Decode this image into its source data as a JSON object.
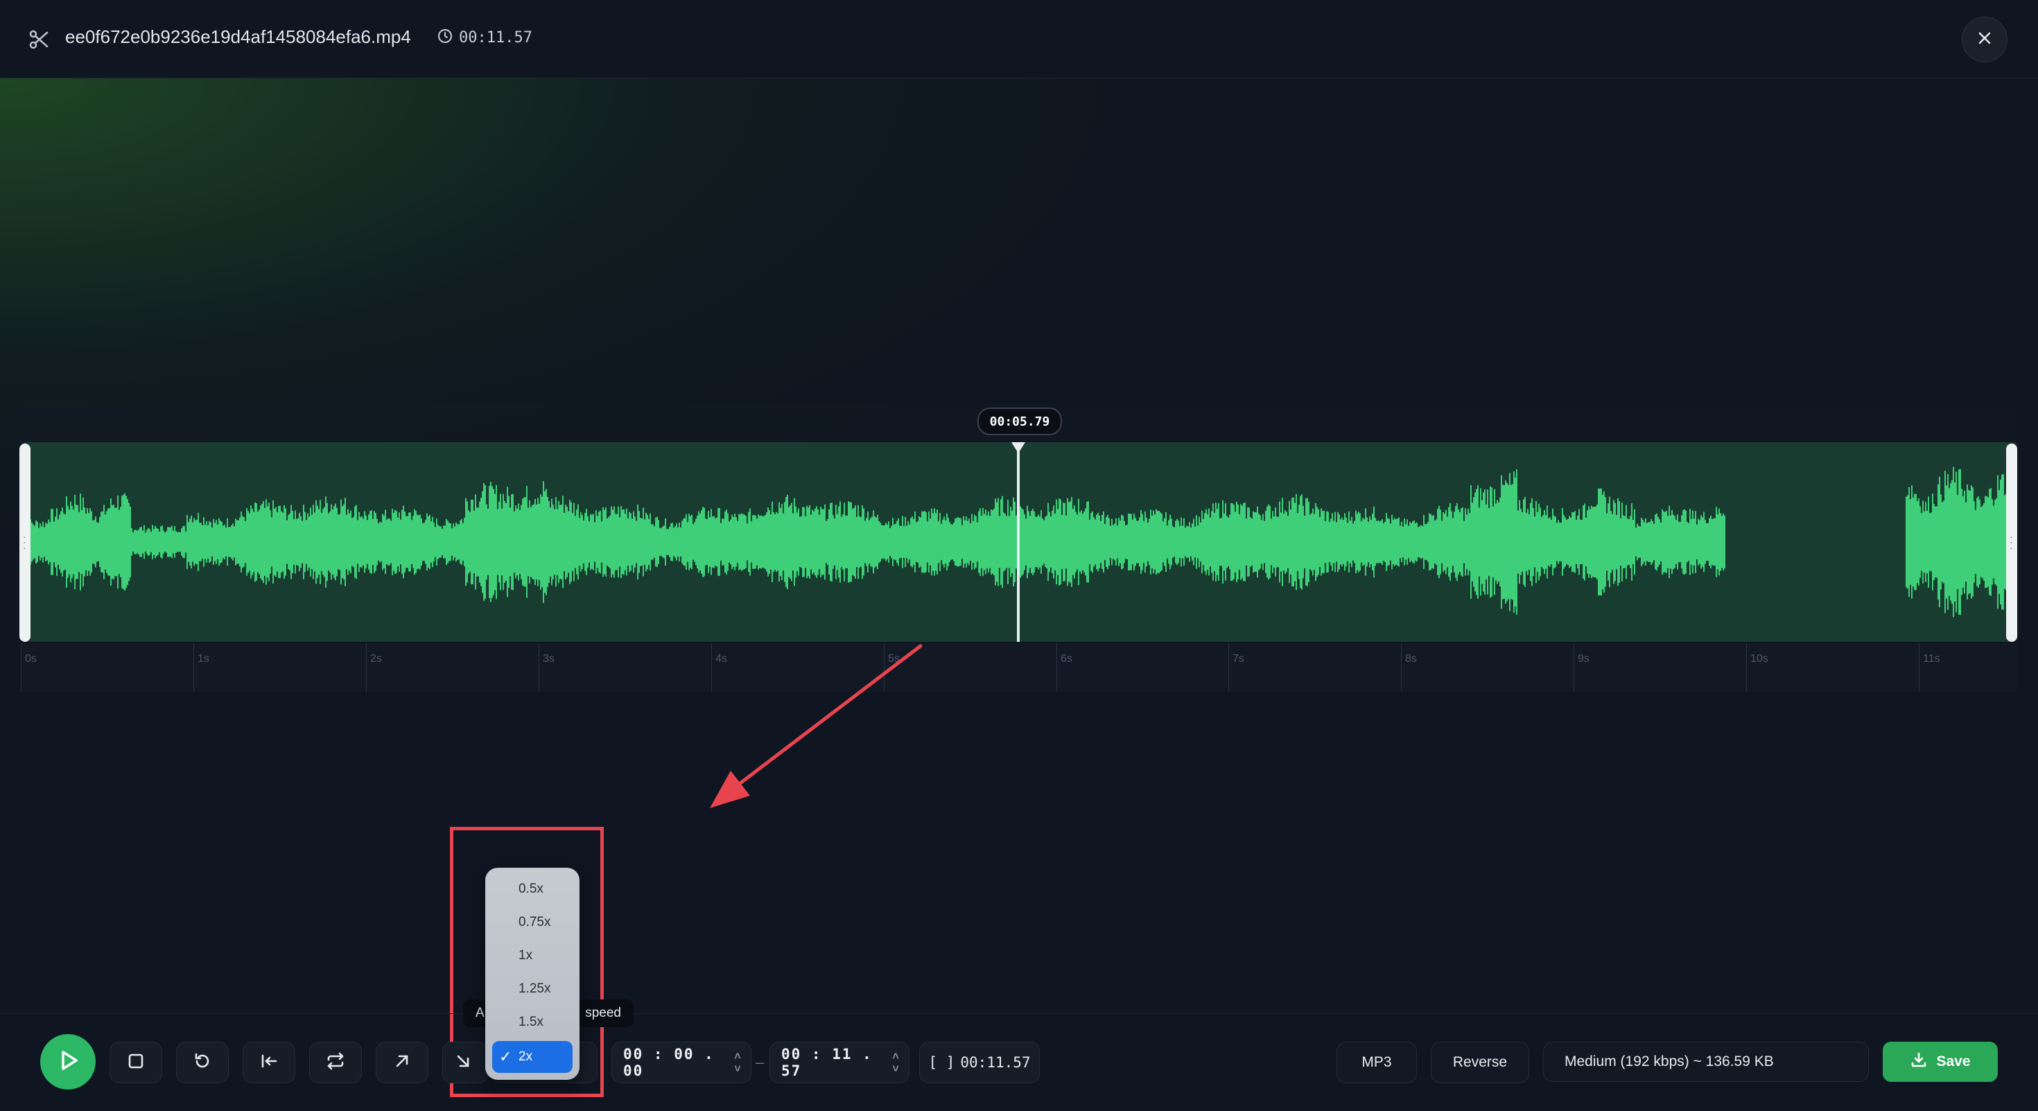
{
  "header": {
    "filename": "ee0f672e0b9236e19d4af1458084efa6.mp4",
    "duration": "00:11.57"
  },
  "waveform": {
    "playhead_time": "00:05.79",
    "playhead_fraction": 0.5,
    "wave_color": "#3ecf78",
    "ruler_labels": [
      "0s",
      "1s",
      "2s",
      "3s",
      "4s",
      "5s",
      "6s",
      "7s",
      "8s",
      "9s",
      "10s",
      "11s"
    ]
  },
  "toolbar": {
    "speed_tooltip_left": "A",
    "speed_tooltip_right": "speed",
    "speed_options": [
      "0.5x",
      "0.75x",
      "1x",
      "1.25x",
      "1.5x",
      "2x"
    ],
    "speed_selected": "2x",
    "start_time": "00 : 00 . 00",
    "end_time": "00 : 11 . 57",
    "selection_length": "00:11.57",
    "selection_icon": "[ ]",
    "format": "MP3",
    "reverse_label": "Reverse",
    "quality_label": "Medium (192 kbps) ~ 136.59 KB",
    "save_label": "Save"
  },
  "colors": {
    "accent_green": "#2db866",
    "annotation_red": "#e8444e",
    "selected_blue": "#1b6ee3"
  }
}
